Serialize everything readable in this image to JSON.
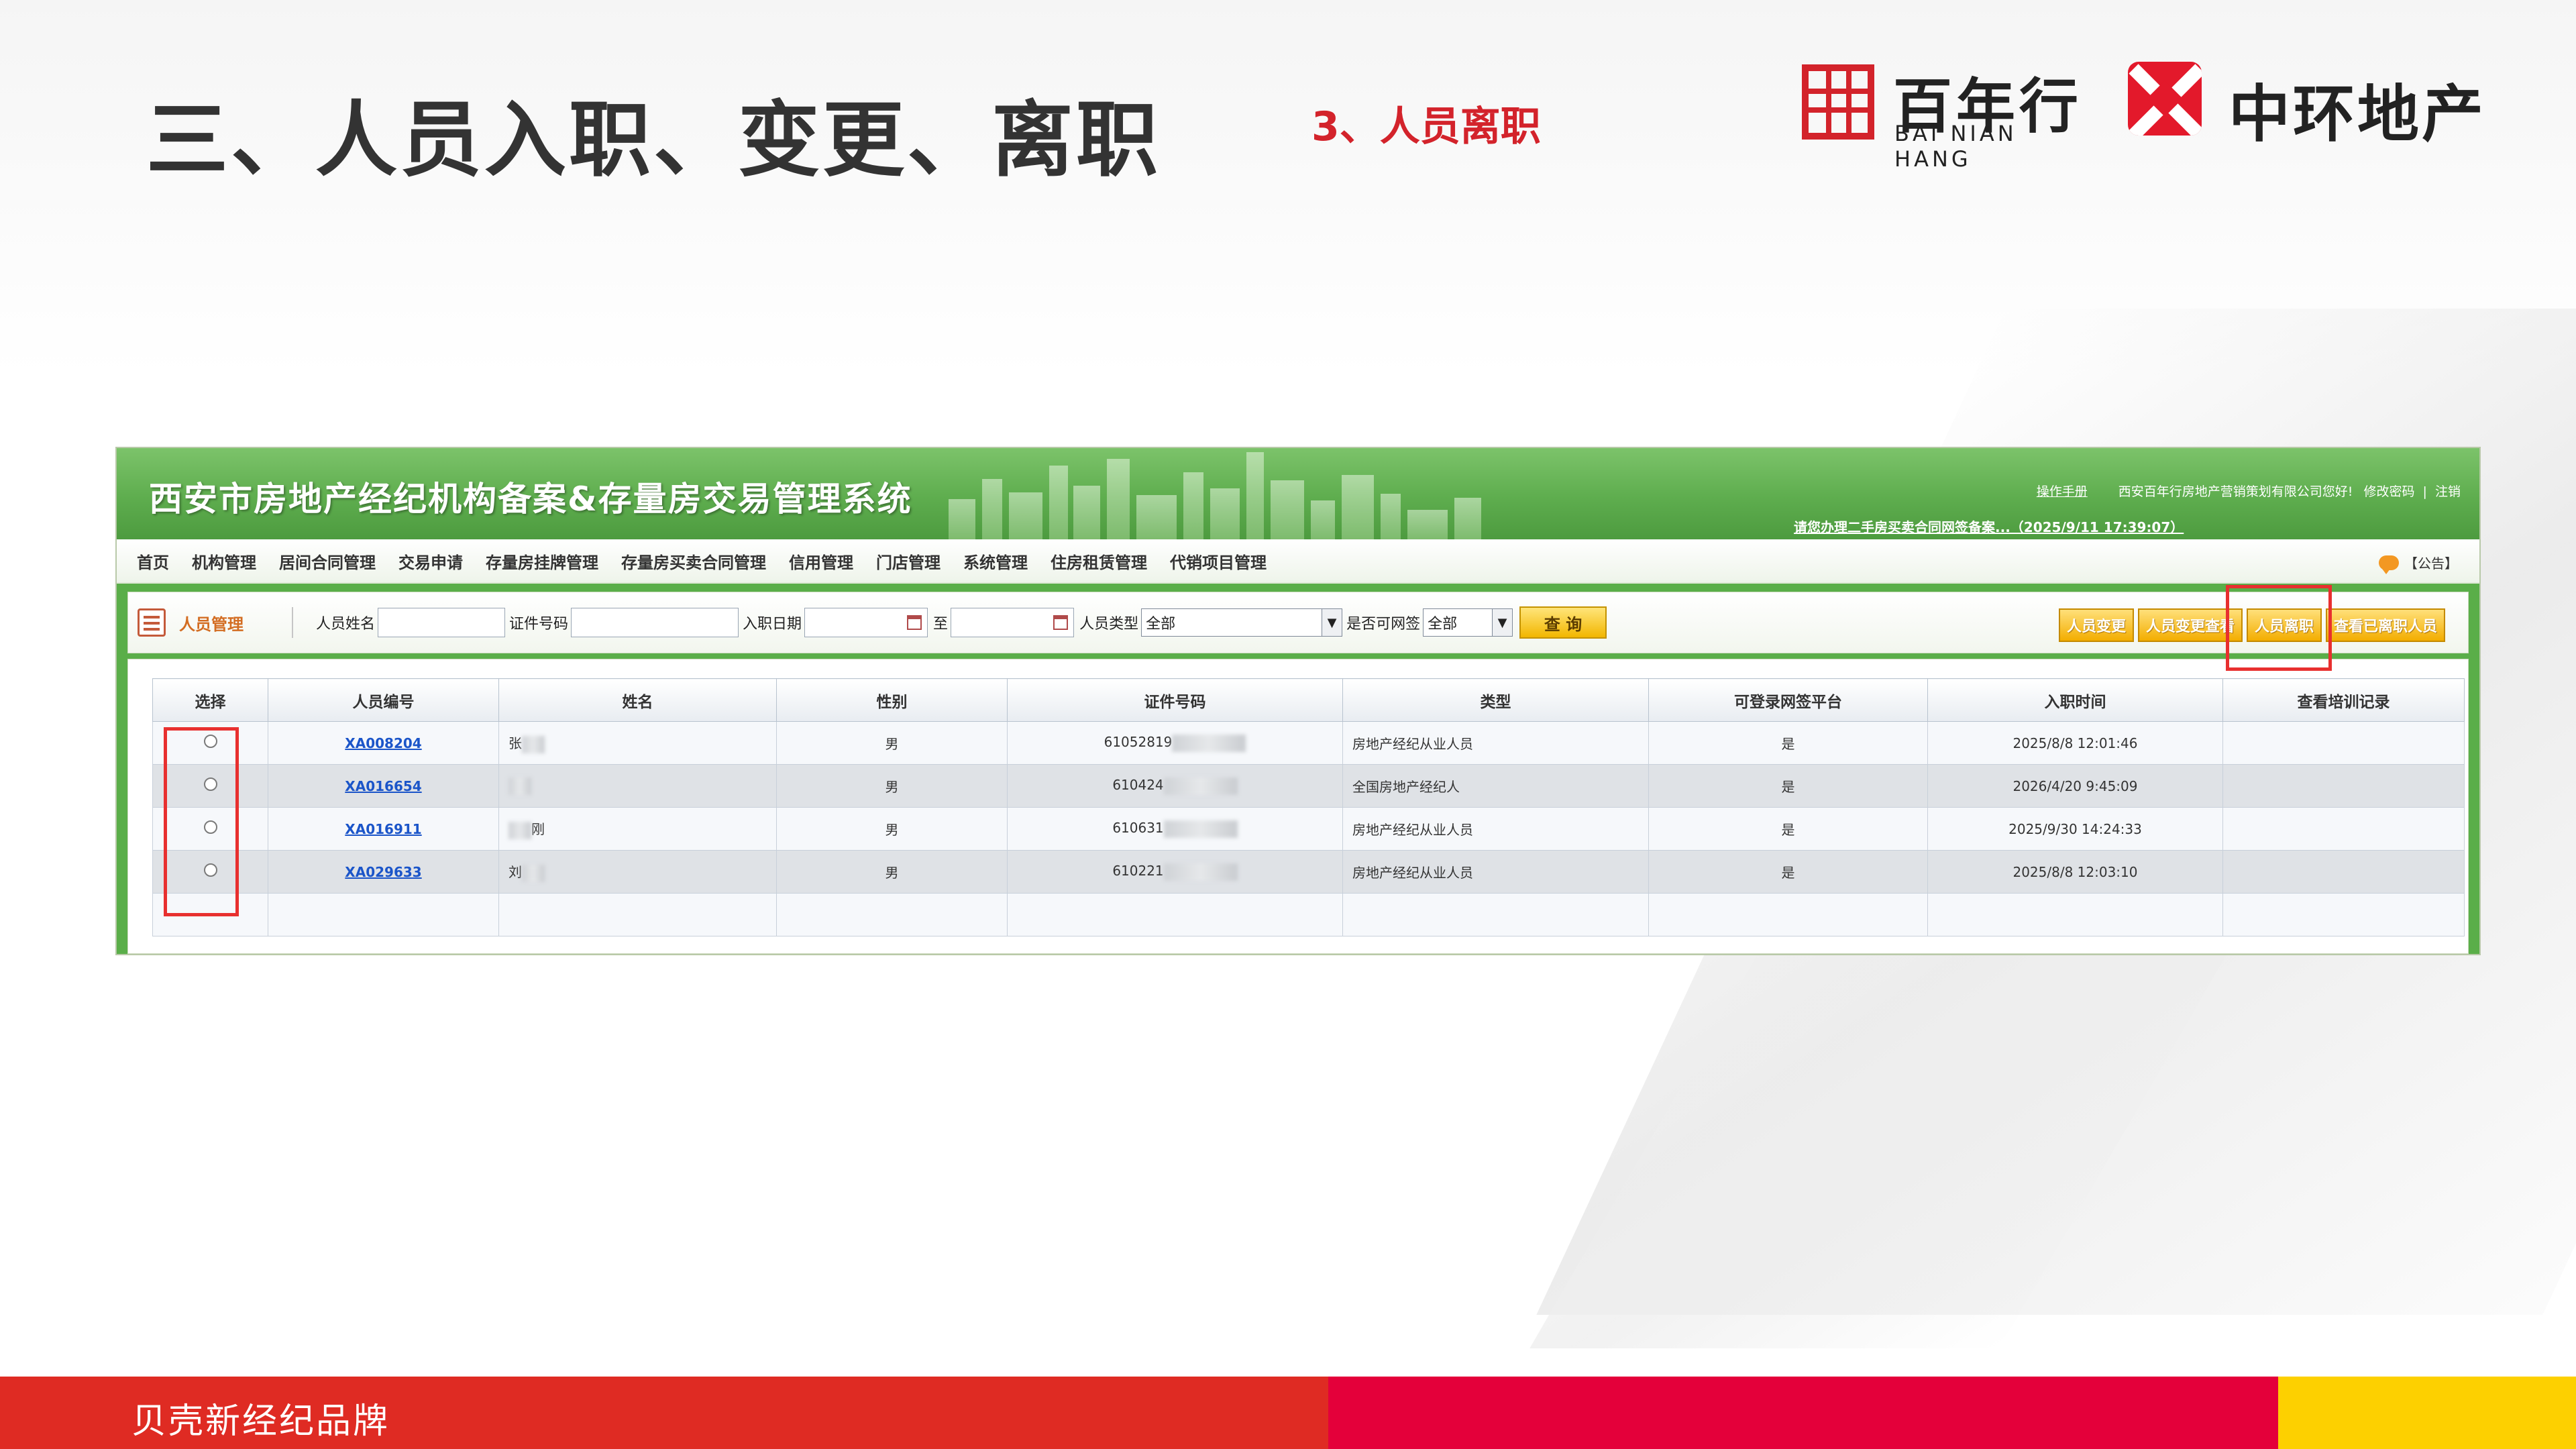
{
  "slide": {
    "title": "三、人员入职、变更、离职",
    "subtitle": "3、人员离职",
    "footer": "贝壳新经纪品牌"
  },
  "logos": {
    "bnh_cn": "百年行",
    "bnh_en": "BAI NIAN HANG",
    "zh_cn": "中环地产"
  },
  "app": {
    "title": "西安市房地产经纪机构备案&存量房交易管理系统",
    "manual_link": "操作手册",
    "greeting": "西安百年行房地产营销策划有限公司您好!",
    "change_password": "修改密码",
    "separator": "|",
    "logout": "注销",
    "marquee": "请您办理二手房买卖合同网签备案...（2025/9/11 17:39:07）",
    "notice": "【公告】",
    "nav": [
      "首页",
      "机构管理",
      "居间合同管理",
      "交易申请",
      "存量房挂牌管理",
      "存量房买卖合同管理",
      "信用管理",
      "门店管理",
      "系统管理",
      "住房租赁管理",
      "代销项目管理"
    ]
  },
  "toolbar": {
    "module": "人员管理",
    "name_label": "人员姓名",
    "name_value": "",
    "id_label": "证件号码",
    "id_value": "",
    "date_label": "入职日期",
    "date_to": "至",
    "type_label": "人员类型",
    "type_value": "全部",
    "sign_label": "是否可网签",
    "sign_value": "全部",
    "query": "查 询",
    "actions": [
      "人员变更",
      "人员变更查看",
      "人员离职",
      "查看已离职人员"
    ]
  },
  "table": {
    "headers": [
      "选择",
      "人员编号",
      "姓名",
      "性别",
      "证件号码",
      "类型",
      "可登录网签平台",
      "入职时间",
      "查看培训记录"
    ],
    "rows": [
      {
        "code": "XA008204",
        "name": "张",
        "gender": "男",
        "id": "61052819",
        "type": "房地产经纪从业人员",
        "can_login": "是",
        "date": "2025/8/8 12:01:46"
      },
      {
        "code": "XA016654",
        "name": "",
        "gender": "男",
        "id": "610424",
        "type": "全国房地产经纪人",
        "can_login": "是",
        "date": "2026/4/20 9:45:09"
      },
      {
        "code": "XA016911",
        "name": "刚",
        "gender": "男",
        "id": "610631",
        "type": "房地产经纪从业人员",
        "can_login": "是",
        "date": "2025/9/30 14:24:33"
      },
      {
        "code": "XA029633",
        "name": "刘",
        "gender": "男",
        "id": "610221",
        "type": "房地产经纪从业人员",
        "can_login": "是",
        "date": "2025/8/8 12:03:10"
      }
    ]
  },
  "colors": {
    "accent_red": "#d3232b",
    "app_green": "#5aae49",
    "highlight": "#e8302f",
    "footer_red": "#df2b23",
    "footer_crimson": "#e4003a",
    "footer_yellow": "#fdd000"
  }
}
